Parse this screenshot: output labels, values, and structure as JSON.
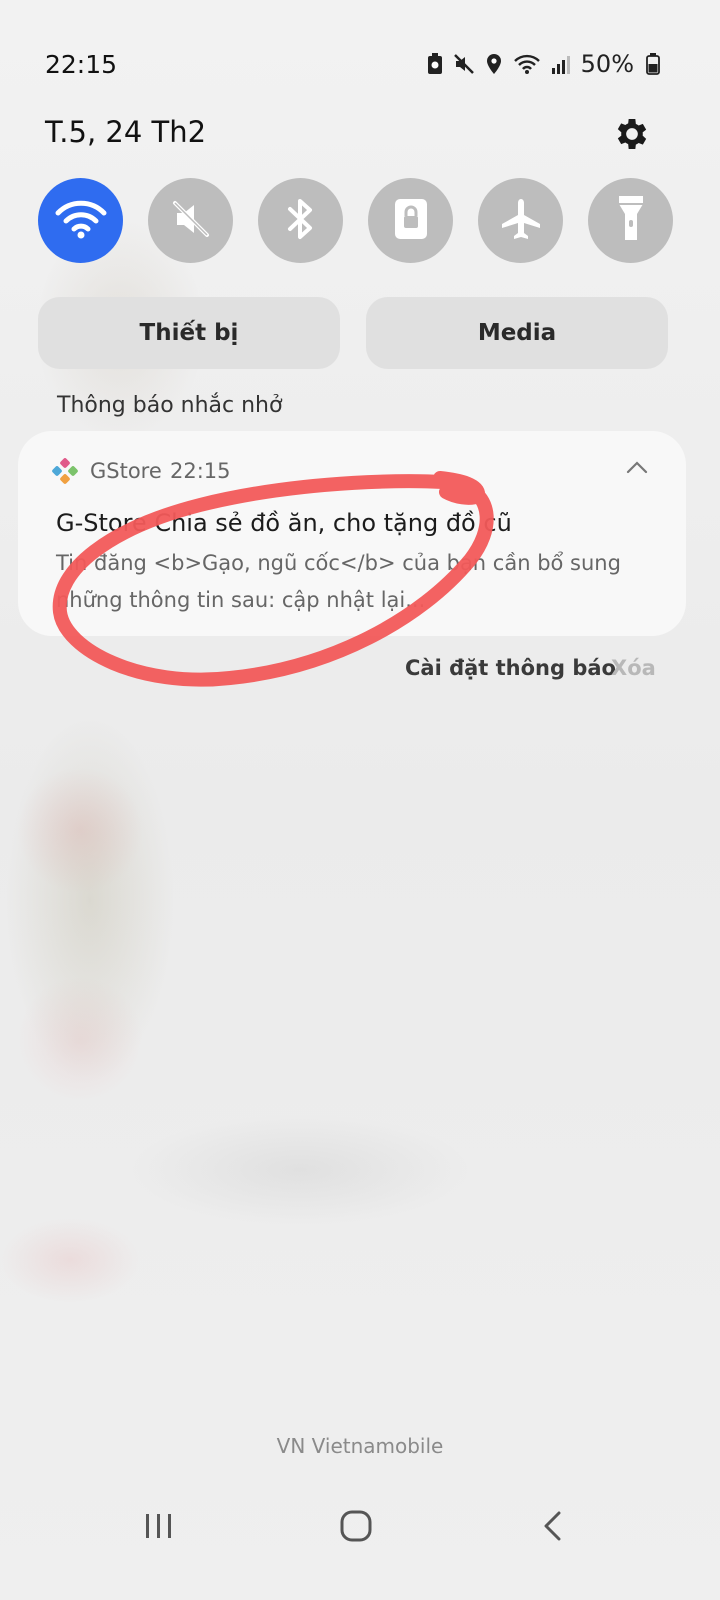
{
  "status_bar": {
    "time": "22:15",
    "battery_percent": "50%",
    "icons": [
      "battery-saver-icon",
      "mute-icon",
      "location-icon",
      "wifi-icon",
      "signal-icon",
      "battery-icon"
    ]
  },
  "header": {
    "date": "T.5, 24 Th2",
    "settings_icon": "gear-icon"
  },
  "quick_toggles": [
    {
      "name": "wifi",
      "icon": "wifi-icon",
      "on": true
    },
    {
      "name": "sound",
      "icon": "mute-icon",
      "on": false
    },
    {
      "name": "bluetooth",
      "icon": "bluetooth-icon",
      "on": false
    },
    {
      "name": "secure-folder",
      "icon": "lock-icon",
      "on": false
    },
    {
      "name": "airplane",
      "icon": "airplane-icon",
      "on": false
    },
    {
      "name": "flashlight",
      "icon": "flashlight-icon",
      "on": false
    }
  ],
  "panel_buttons": {
    "device": "Thiết bị",
    "media": "Media"
  },
  "section_label": "Thông báo nhắc nhở",
  "notification": {
    "app_name": "GStore",
    "time": "22:15",
    "title": "G-Store Chia sẻ đồ ăn, cho tặng đồ cũ",
    "body": "Tin đăng <b>Gạo, ngũ cốc</b> của bạn cần bổ sung những thông tin sau: cập nhật lại..."
  },
  "notification_actions": {
    "settings": "Cài đặt thông báo",
    "clear": "Xóa"
  },
  "carrier": "VN Vietnamobile",
  "colors": {
    "accent": "#2f6cf0",
    "toggle_off": "#bdbdbd",
    "annotation": "#f25a5a"
  }
}
